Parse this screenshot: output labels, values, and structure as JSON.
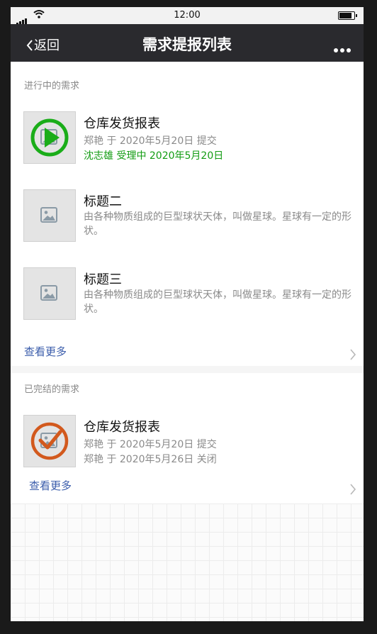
{
  "status_bar": {
    "time": "12:00",
    "signal_icon": "signal-icon",
    "wifi_icon": "wifi-icon",
    "battery_icon": "battery-icon"
  },
  "nav": {
    "back_label": "返回",
    "title": "需求提报列表",
    "more_icon": "ellipsis-icon"
  },
  "colors": {
    "nav_bg": "#2a2a2e",
    "accent_green": "#139c13",
    "accent_orange": "#d2591d",
    "link_blue": "#3a5cab"
  },
  "in_progress": {
    "label": "进行中的需求",
    "items": [
      {
        "title": "仓库发货报表",
        "line1": "郑艳 于 2020年5月20日 提交",
        "line2": "沈志雄 受理中 2020年5月20日",
        "status_icon": "play-circle-icon"
      },
      {
        "title": "标题二",
        "desc": "由各种物质组成的巨型球状天体，叫做星球。星球有一定的形状。"
      },
      {
        "title": "标题三",
        "desc": "由各种物质组成的巨型球状天体，叫做星球。星球有一定的形状。"
      }
    ],
    "more_label": "查看更多"
  },
  "completed": {
    "label": "已完结的需求",
    "items": [
      {
        "title": "仓库发货报表",
        "line1": "郑艳 于 2020年5月20日 提交",
        "line2": "郑艳 于 2020年5月26日 关闭",
        "status_icon": "check-circle-icon"
      }
    ],
    "more_label": "查看更多"
  }
}
